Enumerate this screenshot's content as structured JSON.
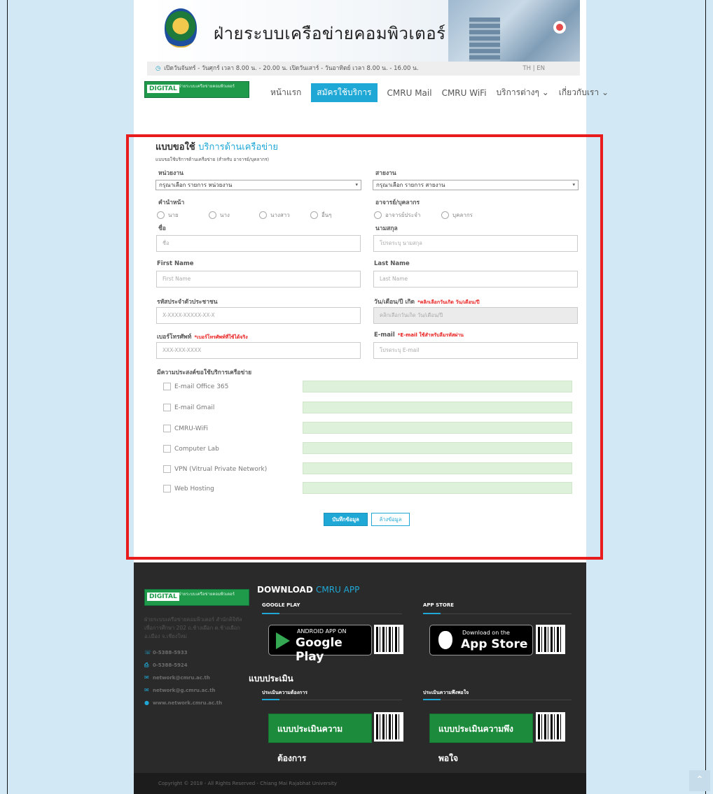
{
  "header": {
    "dept_title": "ฝ่ายระบบเครือข่ายคอมพิวเตอร์",
    "hours": "เปิดวันจันทร์ - วันศุกร์ เวลา 8.00 น. - 20.00 น. เปิดวันเสาร์ - วันอาทิตย์ เวลา 8.00 น. - 16.00 น.",
    "lang_th": "TH",
    "lang_sep": "|",
    "lang_en": "EN"
  },
  "logo": {
    "badge": "DIGITAL",
    "text": "ฝ่ายระบบเครือข่ายคอมพิวเตอร์"
  },
  "nav": {
    "items": [
      "หน้าแรก",
      "สมัครใช้บริการ",
      "CMRU Mail",
      "CMRU WiFi",
      "บริการต่างๆ",
      "เกี่ยวกับเรา"
    ],
    "active_index": 1
  },
  "form": {
    "title_main": "แบบขอใช้",
    "title_accent": "บริการด้านเครือข่าย",
    "subtitle": "แบบขอใช้บริการด้านเครือข่าย (สำหรับ อาจารย์/บุคลากร)",
    "unit_label": "หน่วยงาน",
    "unit_value": "กรุณาเลือก รายการ หน่วยงาน",
    "line_label": "สายงาน",
    "line_value": "กรุณาเลือก รายการ สายงาน",
    "prefix_label": "คำนำหน้า",
    "prefixes": [
      "นาย",
      "นาง",
      "นางสาว",
      "อื่นๆ"
    ],
    "role_label": "อาจารย์/บุคลากร",
    "roles": [
      "อาจารย์ประจำ",
      "บุคลากร"
    ],
    "firstname_th_label": "ชื่อ",
    "firstname_th_placeholder": "ชื่อ",
    "lastname_th_label": "นามสกุล",
    "lastname_th_placeholder": "โปรดระบุ นามสกุล",
    "firstname_en_label": "First Name",
    "firstname_en_placeholder": "First Name",
    "lastname_en_label": "Last Name",
    "lastname_en_placeholder": "Last Name",
    "id_label": "รหัสประจำตัวประชาชน",
    "id_placeholder": "X-XXXX-XXXXX-XX-X",
    "dob_label": "วัน/เดือน/ปี เกิด",
    "dob_note": "*คลิกเลือกวันเกิด วัน/เดือน/ปี",
    "dob_placeholder": "คลิกเลือกวันเกิด วัน/เดือน/ปี",
    "phone_label": "เบอร์โทรศัพท์",
    "phone_note": "*เบอร์โทรศัพท์ที่ใช้ได้จริง",
    "phone_placeholder": "XXX-XXX-XXXX",
    "email_label": "E-mail",
    "email_note": "*E-mail ใช้สำหรับลืมรหัสผ่าน",
    "email_placeholder": "โปรดระบุ E-mail",
    "services_label": "มีความประสงค์ขอใช้บริการเครือข่าย",
    "services": [
      "E-mail Office 365",
      "E-mail Gmail",
      "CMRU-WiFi",
      "Computer Lab",
      "VPN (Vitrual Private Network)",
      "Web Hosting"
    ],
    "save_button": "บันทึกข้อมูล",
    "reset_button": "ล้างข้อมูล"
  },
  "footer": {
    "address": "ฝ่ายระบบเครือข่ายคอมพิวเตอร์ สำนักดิจิทัลเพื่อการศึกษา 202 ถ.ช้างเผือก ต.ช้างเผือก อ.เมือง จ.เชียงใหม่",
    "phone": "0-5388-5933",
    "fax": "0-5388-5924",
    "email1": "network@cmru.ac.th",
    "email2": "network@g.cmru.ac.th",
    "website": "www.network.cmru.ac.th",
    "download_title": "DOWNLOAD",
    "download_accent": "CMRU APP",
    "google_play_label": "GOOGLE PLAY",
    "app_store_label": "APP STORE",
    "gp_small": "ANDROID APP ON",
    "gp_big": "Google Play",
    "as_small": "Download on the",
    "as_big": "App Store",
    "eval_title": "แบบประเมิน",
    "eval_need_label": "ประเมินความต้องการ",
    "eval_satisfaction_label": "ประเมินความพึงพอใจ",
    "eval_need_button": "แบบประเมินความต้องการ",
    "eval_satisfaction_button": "แบบประเมินความพึงพอใจ",
    "copyright": "Copyright © 2018 - All Rights Reserved - Chiang Mai Rajabhat University"
  },
  "colors": {
    "accent": "#1fa8d6",
    "highlight_border": "#e81c1c",
    "brand_green": "#1e9a4a",
    "footer_bg": "#2a2a2a"
  }
}
